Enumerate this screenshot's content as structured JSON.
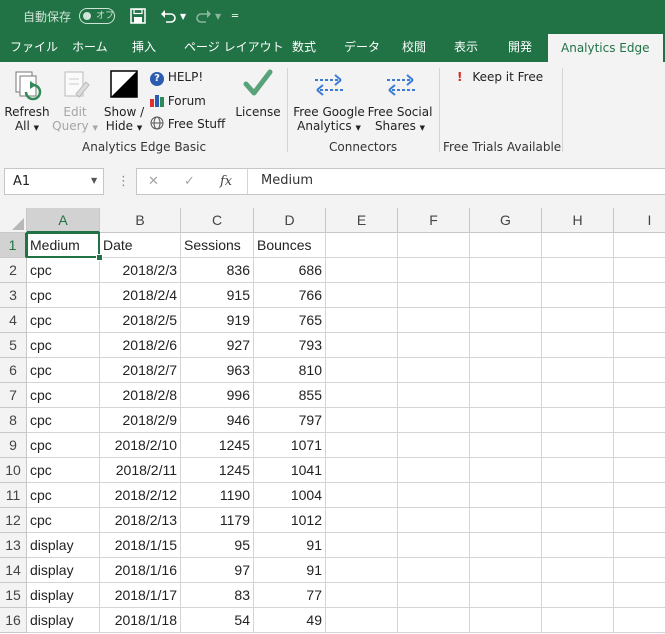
{
  "titlebar": {
    "autosave_label": "自動保存",
    "autosave_toggle": "オフ"
  },
  "menu": {
    "tabs": [
      "ファイル",
      "ホーム",
      "挿入",
      "ページ レイアウト",
      "数式",
      "データ",
      "校閲",
      "表示",
      "開発",
      "Analytics Edge"
    ]
  },
  "ribbon": {
    "refresh": [
      "Refresh",
      "All"
    ],
    "edit_query": [
      "Edit",
      "Query"
    ],
    "show_hide": [
      "Show /",
      "Hide"
    ],
    "help": "HELP!",
    "forum": "Forum",
    "free_stuff": "Free Stuff",
    "license": "License",
    "free_google": [
      "Free Google",
      "Analytics"
    ],
    "free_social": [
      "Free Social",
      "Shares"
    ],
    "keep_free": "Keep it Free",
    "group_basic": "Analytics Edge Basic",
    "group_connectors": "Connectors",
    "group_trials": "Free Trials Available"
  },
  "formula_bar": {
    "name_box": "A1",
    "fx": "fx",
    "value": "Medium"
  },
  "sheet": {
    "columns": [
      "A",
      "B",
      "C",
      "D",
      "E",
      "F",
      "G",
      "H",
      "I"
    ],
    "rows": [
      [
        "Medium",
        "Date",
        "Sessions",
        "Bounces"
      ],
      [
        "cpc",
        "2018/2/3",
        "836",
        "686"
      ],
      [
        "cpc",
        "2018/2/4",
        "915",
        "766"
      ],
      [
        "cpc",
        "2018/2/5",
        "919",
        "765"
      ],
      [
        "cpc",
        "2018/2/6",
        "927",
        "793"
      ],
      [
        "cpc",
        "2018/2/7",
        "963",
        "810"
      ],
      [
        "cpc",
        "2018/2/8",
        "996",
        "855"
      ],
      [
        "cpc",
        "2018/2/9",
        "946",
        "797"
      ],
      [
        "cpc",
        "2018/2/10",
        "1245",
        "1071"
      ],
      [
        "cpc",
        "2018/2/11",
        "1245",
        "1041"
      ],
      [
        "cpc",
        "2018/2/12",
        "1190",
        "1004"
      ],
      [
        "cpc",
        "2018/2/13",
        "1179",
        "1012"
      ],
      [
        "display",
        "2018/1/15",
        "95",
        "91"
      ],
      [
        "display",
        "2018/1/16",
        "97",
        "91"
      ],
      [
        "display",
        "2018/1/17",
        "83",
        "77"
      ],
      [
        "display",
        "2018/1/18",
        "54",
        "49"
      ]
    ]
  },
  "colors": {
    "accent": "#217346"
  }
}
